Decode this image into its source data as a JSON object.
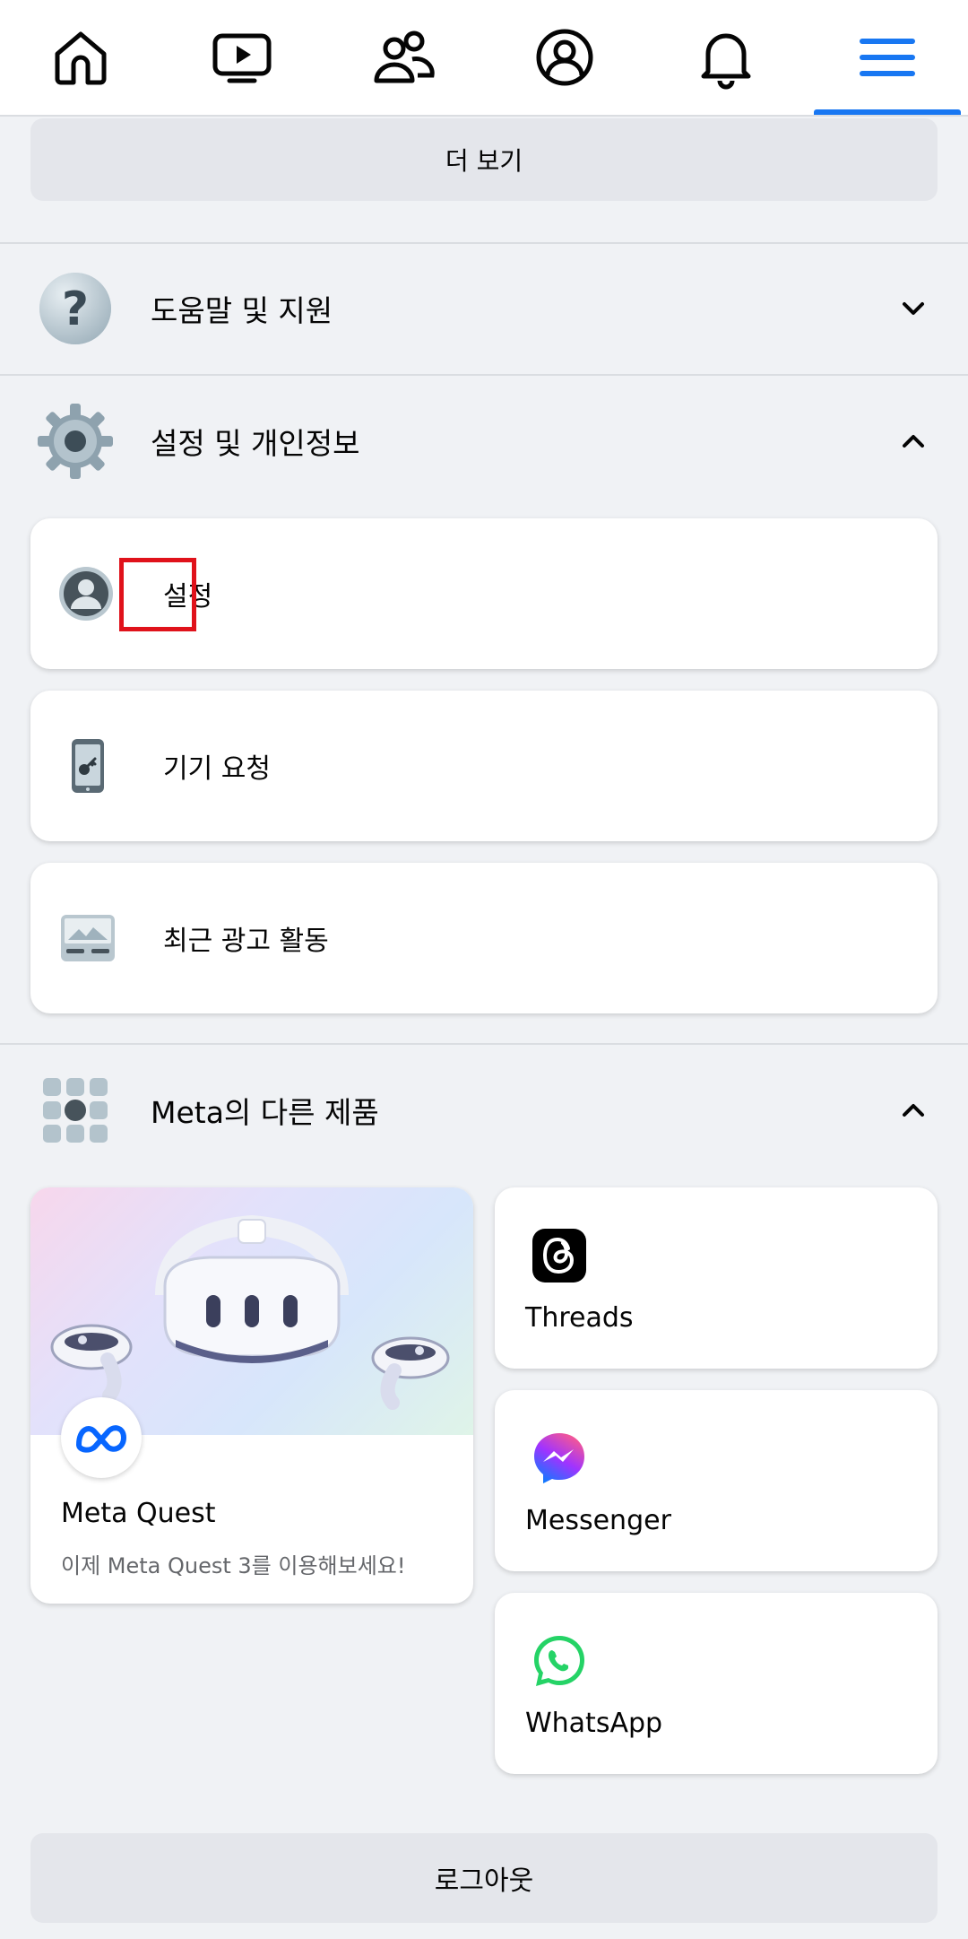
{
  "topnav": {
    "tabs": [
      {
        "icon": "home-icon"
      },
      {
        "icon": "video-icon"
      },
      {
        "icon": "friends-icon"
      },
      {
        "icon": "profile-icon"
      },
      {
        "icon": "bell-icon"
      },
      {
        "icon": "menu-icon",
        "active": true
      }
    ],
    "accent": "#1877f2"
  },
  "see_more_label": "더 보기",
  "help_section": {
    "label": "도움말 및 지원",
    "icon": "question-icon",
    "expanded": false
  },
  "settings_section": {
    "label": "설정 및 개인정보",
    "icon": "gear-icon",
    "expanded": true,
    "items": [
      {
        "label": "설정",
        "icon": "profile-avatar-icon",
        "highlighted": true
      },
      {
        "label": "기기 요청",
        "icon": "phone-key-icon"
      },
      {
        "label": "최근 광고 활동",
        "icon": "ad-activity-icon"
      }
    ]
  },
  "meta_section": {
    "label": "Meta의 다른 제품",
    "icon": "apps-grid-icon",
    "expanded": true,
    "quest": {
      "title": "Meta Quest",
      "subtitle": "이제 Meta Quest 3를 이용해보세요!",
      "icon": "meta-logo-icon"
    },
    "apps": [
      {
        "label": "Threads",
        "icon": "threads-icon"
      },
      {
        "label": "Messenger",
        "icon": "messenger-icon"
      },
      {
        "label": "WhatsApp",
        "icon": "whatsapp-icon"
      }
    ]
  },
  "logout_label": "로그아웃",
  "highlight_color": "#e0121b"
}
